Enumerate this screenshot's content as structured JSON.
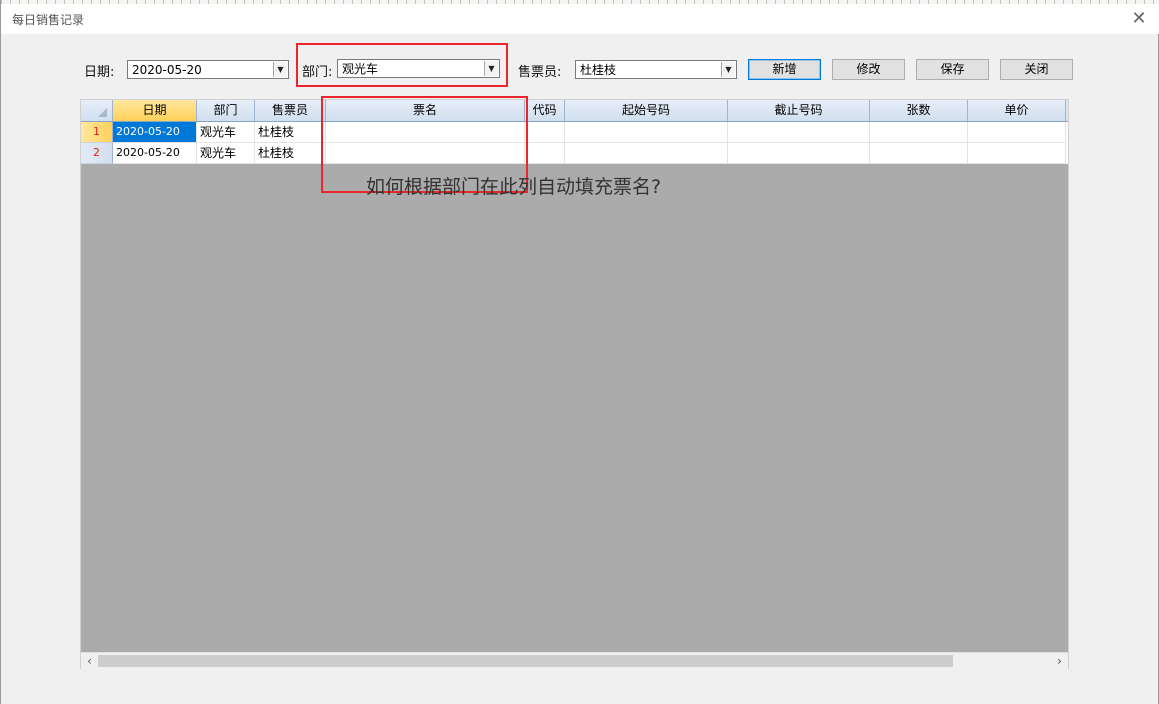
{
  "window": {
    "title": "每日销售记录",
    "close_glyph": "✕"
  },
  "filters": {
    "date_label": "日期:",
    "date_value": "2020-05-20",
    "dept_label": "部门:",
    "dept_value": "观光车",
    "seller_label": "售票员:",
    "seller_value": "杜桂枝",
    "dropdown_glyph": "▼"
  },
  "buttons": {
    "add": "新增",
    "edit": "修改",
    "save": "保存",
    "close": "关闭"
  },
  "grid": {
    "columns": [
      "日期",
      "部门",
      "售票员",
      "票名",
      "代码",
      "起始号码",
      "截止号码",
      "张数",
      "单价"
    ],
    "rows": [
      {
        "num": "1",
        "date": "2020-05-20",
        "dept": "观光车",
        "seller": "杜桂枝",
        "ticket_name": "",
        "code": "",
        "start_no": "",
        "end_no": "",
        "count": "",
        "price": ""
      },
      {
        "num": "2",
        "date": "2020-05-20",
        "dept": "观光车",
        "seller": "杜桂枝",
        "ticket_name": "",
        "code": "",
        "start_no": "",
        "end_no": "",
        "count": "",
        "price": ""
      }
    ]
  },
  "annotation": {
    "text": "如何根据部门在此列自动填充票名?",
    "highlight_color": "#e8262b"
  },
  "scrollbar": {
    "left_glyph": "‹",
    "right_glyph": "›"
  }
}
